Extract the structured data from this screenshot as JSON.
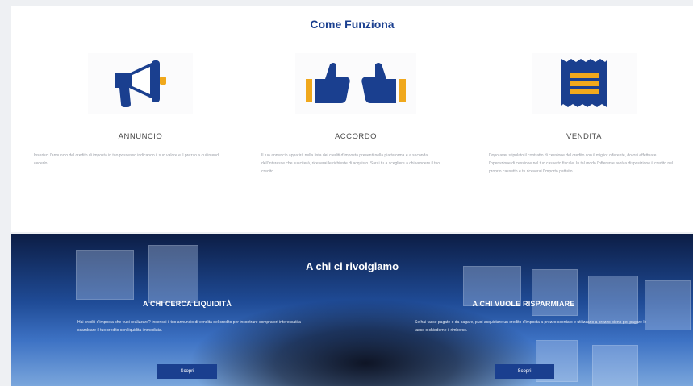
{
  "how_it_works": {
    "title": "Come Funziona",
    "steps": [
      {
        "icon": "megaphone-icon",
        "title": "ANNUNCIO",
        "description": "Inserisci l'annuncio del credito di imposta in tuo possesso indicando il suo valore e il prezzo a cui intendi cederlo."
      },
      {
        "icon": "thumbs-up-icon",
        "title": "ACCORDO",
        "description": "Il tuo annuncio apparirà nella lista dei crediti d'imposta presenti nella piattaforma e a seconda dell'interesse che susciterà, riceverai le richieste di acquisto. Sarai tu a scegliere a chi vendere il tuo credito."
      },
      {
        "icon": "receipt-icon",
        "title": "VENDITA",
        "description": "Dopo aver stipulato il contratto di cessione del credito con il miglior offerente, dovrai effettuare l'operazione di cessione nel tuo cassetto fiscale. In tal modo l'offerente avrà a disposizione il credito nel proprio cassetto e tu riceverai l'importo pattuito."
      }
    ]
  },
  "audience": {
    "title": "A chi ci rivolgiamo",
    "columns": [
      {
        "title": "A CHI CERCA LIQUIDITÀ",
        "description": "Hai crediti d'imposta che vuoi realizzare? Inserisci il tuo annuncio di vendita del credito per incontrare compratori interessati a scambiare il tuo credito con liquidità immediata.",
        "button": "Scopri"
      },
      {
        "title": "A CHI VUOLE RISPARMIARE",
        "description": "Se hai tasse pagate o da pagare, puoi acquistare un credito d'imposta a prezzo scontato e utilizzarlo a prezzo pieno per pagare le tasse o chiederne il rimborso.",
        "button": "Scopri"
      }
    ]
  },
  "colors": {
    "brand_blue": "#1a3f8f",
    "accent_yellow": "#f0a81c"
  }
}
